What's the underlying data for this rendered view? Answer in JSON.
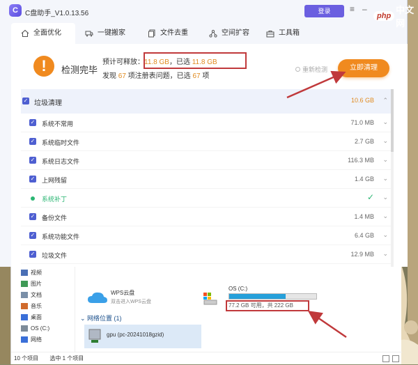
{
  "app": {
    "title": "C盘助手_V1.0.13.56",
    "logo_letter": "C",
    "login_label": "登录",
    "tabs": [
      {
        "label": "全面优化",
        "icon": "home-icon",
        "active": true
      },
      {
        "label": "一键搬家",
        "icon": "truck-icon",
        "active": false
      },
      {
        "label": "文件去重",
        "icon": "copy-icon",
        "active": false
      },
      {
        "label": "空间扩容",
        "icon": "expand-icon",
        "active": false
      },
      {
        "label": "工具箱",
        "icon": "toolbox-icon",
        "active": false
      }
    ],
    "status": {
      "icon": "exclamation-icon",
      "title": "检测完毕",
      "line1_prefix": "预计可释放：",
      "line1_size": "11.8 GB",
      "line1_mid": "，已选",
      "line1_selected": "11.8 GB",
      "line2_prefix": "发现",
      "line2_count": "67",
      "line2_mid": "项注册表问题，已选",
      "line2_selected": "67",
      "line2_suffix": "项",
      "rescan_label": "重新检测",
      "clean_label": "立即清理"
    },
    "list": {
      "header": {
        "label": "垃圾清理",
        "size": "10.6 GB"
      },
      "rows": [
        {
          "label": "系统不常用",
          "size": "71.0 MB",
          "state": "checked"
        },
        {
          "label": "系统临时文件",
          "size": "2.7 GB",
          "state": "checked"
        },
        {
          "label": "系统日志文件",
          "size": "116.3 MB",
          "state": "checked"
        },
        {
          "label": "上网残留",
          "size": "1.4 GB",
          "state": "checked"
        },
        {
          "label": "系统补丁",
          "size": "",
          "state": "done"
        },
        {
          "label": "备份文件",
          "size": "1.4 MB",
          "state": "checked"
        },
        {
          "label": "系统功能文件",
          "size": "6.4 GB",
          "state": "checked"
        },
        {
          "label": "垃圾文件",
          "size": "12.9 MB",
          "state": "checked"
        }
      ]
    },
    "colors": {
      "accent": "#f08a1f",
      "primary": "#4e5fd1",
      "highlight": "#c0393b",
      "success": "#2bb673"
    }
  },
  "explorer": {
    "sidebar": [
      {
        "label": "视频",
        "icon": "video-icon"
      },
      {
        "label": "图片",
        "icon": "picture-icon"
      },
      {
        "label": "文档",
        "icon": "document-icon"
      },
      {
        "label": "音乐",
        "icon": "music-icon"
      },
      {
        "label": "桌面",
        "icon": "desktop-icon"
      },
      {
        "label": "OS (C:)",
        "icon": "drive-icon"
      },
      {
        "label": "网络",
        "icon": "network-icon"
      }
    ],
    "wps": {
      "title": "WPS云盘",
      "subtitle": "双击进入WPS云盘"
    },
    "drive": {
      "name": "OS (C:)",
      "info": "77.2 GB 可用，共 222 GB",
      "used_fraction": 0.65
    },
    "network": {
      "header": "网络位置 (1)",
      "item": "gpu (pc-20241018gzid)"
    },
    "status": {
      "count": "10 个项目",
      "selected": "选中 1 个项目"
    }
  },
  "watermark": {
    "php": "php",
    "text": "中文网"
  }
}
